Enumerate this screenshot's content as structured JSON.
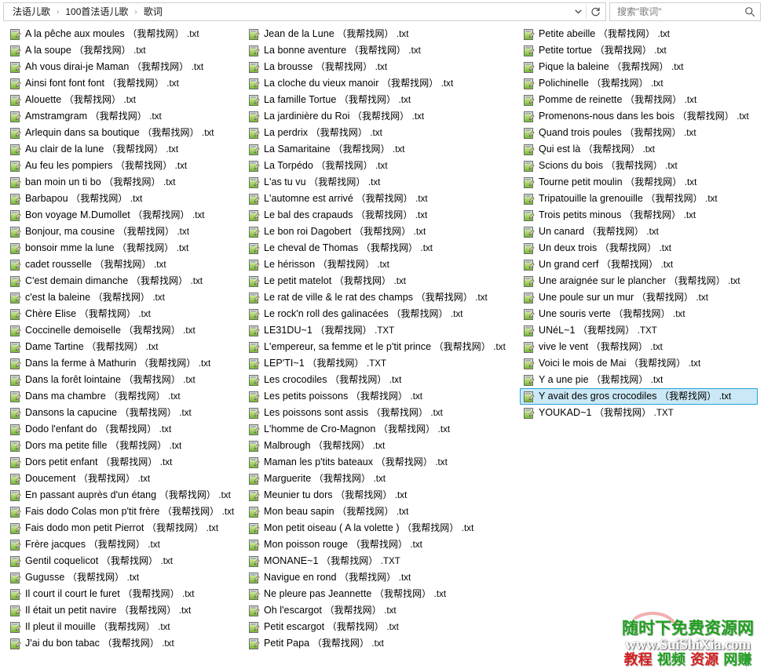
{
  "window": {
    "title": "歌词",
    "type": "file-explorer"
  },
  "address_bar": {
    "breadcrumbs": [
      "法语儿歌",
      "100首法语儿歌",
      "歌词"
    ],
    "separator": "›",
    "chevron_icon": "chevron-down-icon",
    "refresh_icon": "refresh-icon"
  },
  "search": {
    "placeholder": "搜索\"歌词\"",
    "icon": "search-icon"
  },
  "file_list": {
    "icon_name": "text-file-icon",
    "tag": "（我帮找网）",
    "selected_index": 94,
    "columns": [
      {
        "index": 0,
        "files": [
          {
            "name": "A la pêche aux moules",
            "tag": "（我帮找网）",
            "ext": ".txt"
          },
          {
            "name": "A la soupe",
            "tag": "（我帮找网）",
            "ext": ".txt"
          },
          {
            "name": "Ah vous dirai-je Maman",
            "tag": "（我帮找网）",
            "ext": ".txt"
          },
          {
            "name": "Ainsi font font font",
            "tag": "（我帮找网）",
            "ext": ".txt"
          },
          {
            "name": "Alouette",
            "tag": "（我帮找网）",
            "ext": ".txt"
          },
          {
            "name": "Amstramgram",
            "tag": "（我帮找网）",
            "ext": ".txt"
          },
          {
            "name": "Arlequin dans sa boutique",
            "tag": "（我帮找网）",
            "ext": ".txt"
          },
          {
            "name": "Au clair de la lune",
            "tag": "（我帮找网）",
            "ext": ".txt"
          },
          {
            "name": "Au feu les pompiers",
            "tag": "（我帮找网）",
            "ext": ".txt"
          },
          {
            "name": "ban moin un ti bo",
            "tag": "（我帮找网）",
            "ext": ".txt"
          },
          {
            "name": "Barbapou",
            "tag": "（我帮找网）",
            "ext": ".txt"
          },
          {
            "name": "Bon voyage M.Dumollet",
            "tag": "（我帮找网）",
            "ext": ".txt"
          },
          {
            "name": "Bonjour, ma cousine",
            "tag": "（我帮找网）",
            "ext": ".txt"
          },
          {
            "name": "bonsoir mme la lune",
            "tag": "（我帮找网）",
            "ext": ".txt"
          },
          {
            "name": "cadet rousselle",
            "tag": "（我帮找网）",
            "ext": ".txt"
          },
          {
            "name": "C'est demain dimanche",
            "tag": "（我帮找网）",
            "ext": ".txt"
          },
          {
            "name": "c'est la baleine",
            "tag": "（我帮找网）",
            "ext": ".txt"
          },
          {
            "name": "Chère Elise",
            "tag": "（我帮找网）",
            "ext": ".txt"
          },
          {
            "name": "Coccinelle demoiselle",
            "tag": "（我帮找网）",
            "ext": ".txt"
          },
          {
            "name": "Dame Tartine",
            "tag": "（我帮找网）",
            "ext": ".txt"
          },
          {
            "name": "Dans la ferme à Mathurin",
            "tag": "（我帮找网）",
            "ext": ".txt"
          },
          {
            "name": "Dans la forêt lointaine",
            "tag": "（我帮找网）",
            "ext": ".txt"
          },
          {
            "name": "Dans ma chambre",
            "tag": "（我帮找网）",
            "ext": ".txt"
          },
          {
            "name": "Dansons la capucine",
            "tag": "（我帮找网）",
            "ext": ".txt"
          },
          {
            "name": "Dodo l'enfant do",
            "tag": "（我帮找网）",
            "ext": ".txt"
          },
          {
            "name": "Dors ma petite fille",
            "tag": "（我帮找网）",
            "ext": ".txt"
          },
          {
            "name": "Dors petit enfant",
            "tag": "（我帮找网）",
            "ext": ".txt"
          },
          {
            "name": "Doucement",
            "tag": "（我帮找网）",
            "ext": ".txt"
          },
          {
            "name": "En passant auprès d'un étang",
            "tag": "（我帮找网）",
            "ext": ".txt"
          },
          {
            "name": "Fais dodo Colas mon p'tit frère",
            "tag": "（我帮找网）",
            "ext": ".txt"
          },
          {
            "name": "Fais dodo mon petit Pierrot",
            "tag": "（我帮找网）",
            "ext": ".txt"
          },
          {
            "name": "Frère jacques",
            "tag": "（我帮找网）",
            "ext": ".txt"
          },
          {
            "name": "Gentil coquelicot",
            "tag": "（我帮找网）",
            "ext": ".txt"
          },
          {
            "name": "Gugusse",
            "tag": "（我帮找网）",
            "ext": ".txt"
          },
          {
            "name": "Il court il court le furet",
            "tag": "（我帮找网）",
            "ext": ".txt"
          },
          {
            "name": "Il était un petit navire",
            "tag": "（我帮找网）",
            "ext": ".txt"
          },
          {
            "name": "Il pleut il mouille",
            "tag": "（我帮找网）",
            "ext": ".txt"
          },
          {
            "name": "J'ai du bon tabac",
            "tag": "（我帮找网）",
            "ext": ".txt"
          }
        ]
      },
      {
        "index": 1,
        "files": [
          {
            "name": "Jean de la Lune",
            "tag": "（我帮找网）",
            "ext": ".txt"
          },
          {
            "name": "La bonne aventure",
            "tag": "（我帮找网）",
            "ext": ".txt"
          },
          {
            "name": "La brousse",
            "tag": "（我帮找网）",
            "ext": ".txt"
          },
          {
            "name": "La cloche du vieux manoir",
            "tag": "（我帮找网）",
            "ext": ".txt"
          },
          {
            "name": "La famille Tortue",
            "tag": "（我帮找网）",
            "ext": ".txt"
          },
          {
            "name": "La jardinière du Roi",
            "tag": "（我帮找网）",
            "ext": ".txt"
          },
          {
            "name": "La perdrix",
            "tag": "（我帮找网）",
            "ext": ".txt"
          },
          {
            "name": "La Samaritaine",
            "tag": "（我帮找网）",
            "ext": ".txt"
          },
          {
            "name": "La Torpédo",
            "tag": "（我帮找网）",
            "ext": ".txt"
          },
          {
            "name": "L'as tu vu",
            "tag": "（我帮找网）",
            "ext": ".txt"
          },
          {
            "name": "L'automne est arrivé",
            "tag": "（我帮找网）",
            "ext": ".txt"
          },
          {
            "name": "Le bal des crapauds",
            "tag": "（我帮找网）",
            "ext": ".txt"
          },
          {
            "name": "Le bon roi Dagobert",
            "tag": "（我帮找网）",
            "ext": ".txt"
          },
          {
            "name": "Le cheval de Thomas",
            "tag": "（我帮找网）",
            "ext": ".txt"
          },
          {
            "name": "Le hérisson",
            "tag": "（我帮找网）",
            "ext": ".txt"
          },
          {
            "name": "Le petit matelot",
            "tag": "（我帮找网）",
            "ext": ".txt"
          },
          {
            "name": "Le rat de ville & le rat des champs",
            "tag": "（我帮找网）",
            "ext": ".txt"
          },
          {
            "name": "Le rock'n roll des galinacées",
            "tag": "（我帮找网）",
            "ext": ".txt"
          },
          {
            "name": "LE31DU~1",
            "tag": "（我帮找网）",
            "ext": ".TXT"
          },
          {
            "name": "L'empereur, sa femme et le p'tit prince",
            "tag": "（我帮找网）",
            "ext": ".txt"
          },
          {
            "name": "LEP'TI~1",
            "tag": "（我帮找网）",
            "ext": ".TXT"
          },
          {
            "name": "Les crocodiles",
            "tag": "（我帮找网）",
            "ext": ".txt"
          },
          {
            "name": "Les petits poissons",
            "tag": "（我帮找网）",
            "ext": ".txt"
          },
          {
            "name": "Les poissons sont assis",
            "tag": "（我帮找网）",
            "ext": ".txt"
          },
          {
            "name": "L'homme de Cro-Magnon",
            "tag": "（我帮找网）",
            "ext": ".txt"
          },
          {
            "name": "Malbrough",
            "tag": "（我帮找网）",
            "ext": ".txt"
          },
          {
            "name": "Maman les p'tits bateaux",
            "tag": "（我帮找网）",
            "ext": ".txt"
          },
          {
            "name": "Marguerite",
            "tag": "（我帮找网）",
            "ext": ".txt"
          },
          {
            "name": "Meunier tu dors",
            "tag": "（我帮找网）",
            "ext": ".txt"
          },
          {
            "name": "Mon beau sapin",
            "tag": "（我帮找网）",
            "ext": ".txt"
          },
          {
            "name": "Mon petit oiseau ( A la volette )",
            "tag": "（我帮找网）",
            "ext": ".txt"
          },
          {
            "name": "Mon poisson rouge",
            "tag": "（我帮找网）",
            "ext": ".txt"
          },
          {
            "name": "MONANE~1",
            "tag": "（我帮找网）",
            "ext": ".TXT"
          },
          {
            "name": "Navigue en rond",
            "tag": "（我帮找网）",
            "ext": ".txt"
          },
          {
            "name": "Ne pleure pas Jeannette",
            "tag": "（我帮找网）",
            "ext": ".txt"
          },
          {
            "name": "Oh l'escargot",
            "tag": "（我帮找网）",
            "ext": ".txt"
          },
          {
            "name": "Petit escargot",
            "tag": "（我帮找网）",
            "ext": ".txt"
          },
          {
            "name": "Petit Papa",
            "tag": "（我帮找网）",
            "ext": ".txt"
          }
        ]
      },
      {
        "index": 2,
        "files": [
          {
            "name": "Petite abeille",
            "tag": "（我帮找网）",
            "ext": ".txt"
          },
          {
            "name": "Petite tortue",
            "tag": "（我帮找网）",
            "ext": ".txt"
          },
          {
            "name": "Pique la baleine",
            "tag": "（我帮找网）",
            "ext": ".txt"
          },
          {
            "name": "Polichinelle",
            "tag": "（我帮找网）",
            "ext": ".txt"
          },
          {
            "name": "Pomme de reinette",
            "tag": "（我帮找网）",
            "ext": ".txt"
          },
          {
            "name": "Promenons-nous dans les bois",
            "tag": "（我帮找网）",
            "ext": ".txt"
          },
          {
            "name": "Quand trois poules",
            "tag": "（我帮找网）",
            "ext": ".txt"
          },
          {
            "name": "Qui est là",
            "tag": "（我帮找网）",
            "ext": ".txt"
          },
          {
            "name": "Scions du bois",
            "tag": "（我帮找网）",
            "ext": ".txt"
          },
          {
            "name": "Tourne petit moulin",
            "tag": "（我帮找网）",
            "ext": ".txt"
          },
          {
            "name": "Tripatouille la grenouille",
            "tag": "（我帮找网）",
            "ext": ".txt"
          },
          {
            "name": "Trois petits minous",
            "tag": "（我帮找网）",
            "ext": ".txt"
          },
          {
            "name": "Un canard",
            "tag": "（我帮找网）",
            "ext": ".txt"
          },
          {
            "name": "Un deux trois",
            "tag": "（我帮找网）",
            "ext": ".txt"
          },
          {
            "name": "Un grand cerf",
            "tag": "（我帮找网）",
            "ext": ".txt"
          },
          {
            "name": "Une araignée sur le plancher",
            "tag": "（我帮找网）",
            "ext": ".txt"
          },
          {
            "name": "Une poule sur un mur",
            "tag": "（我帮找网）",
            "ext": ".txt"
          },
          {
            "name": "Une souris verte",
            "tag": "（我帮找网）",
            "ext": ".txt"
          },
          {
            "name": "UNéL~1",
            "tag": "（我帮找网）",
            "ext": ".TXT"
          },
          {
            "name": "vive le vent",
            "tag": "（我帮找网）",
            "ext": ".txt"
          },
          {
            "name": "Voici le mois de Mai",
            "tag": "（我帮找网）",
            "ext": ".txt"
          },
          {
            "name": "Y a une pie",
            "tag": "（我帮找网）",
            "ext": ".txt"
          },
          {
            "name": "Y avait des gros crocodiles",
            "tag": "（我帮找网）",
            "ext": ".txt",
            "selected": true
          },
          {
            "name": "YOUKAD~1",
            "tag": "（我帮找网）",
            "ext": ".TXT"
          }
        ]
      }
    ]
  },
  "watermark": {
    "line1": "随时下免费资源网",
    "line2": "www.SuiShiXia.com",
    "line3": [
      {
        "text": "教程",
        "color": "#d42020"
      },
      {
        "text": "视频",
        "color": "#1fa01f"
      },
      {
        "text": "资源",
        "color": "#d42020"
      },
      {
        "text": "网赚",
        "color": "#1fa01f"
      }
    ]
  },
  "colors": {
    "selection_fill": "#cbe8f6",
    "selection_border": "#26a0da",
    "icon_green": "#8dc63f",
    "text": "#000000",
    "placeholder": "#7b7b7b",
    "border": "#cfcfcf"
  }
}
